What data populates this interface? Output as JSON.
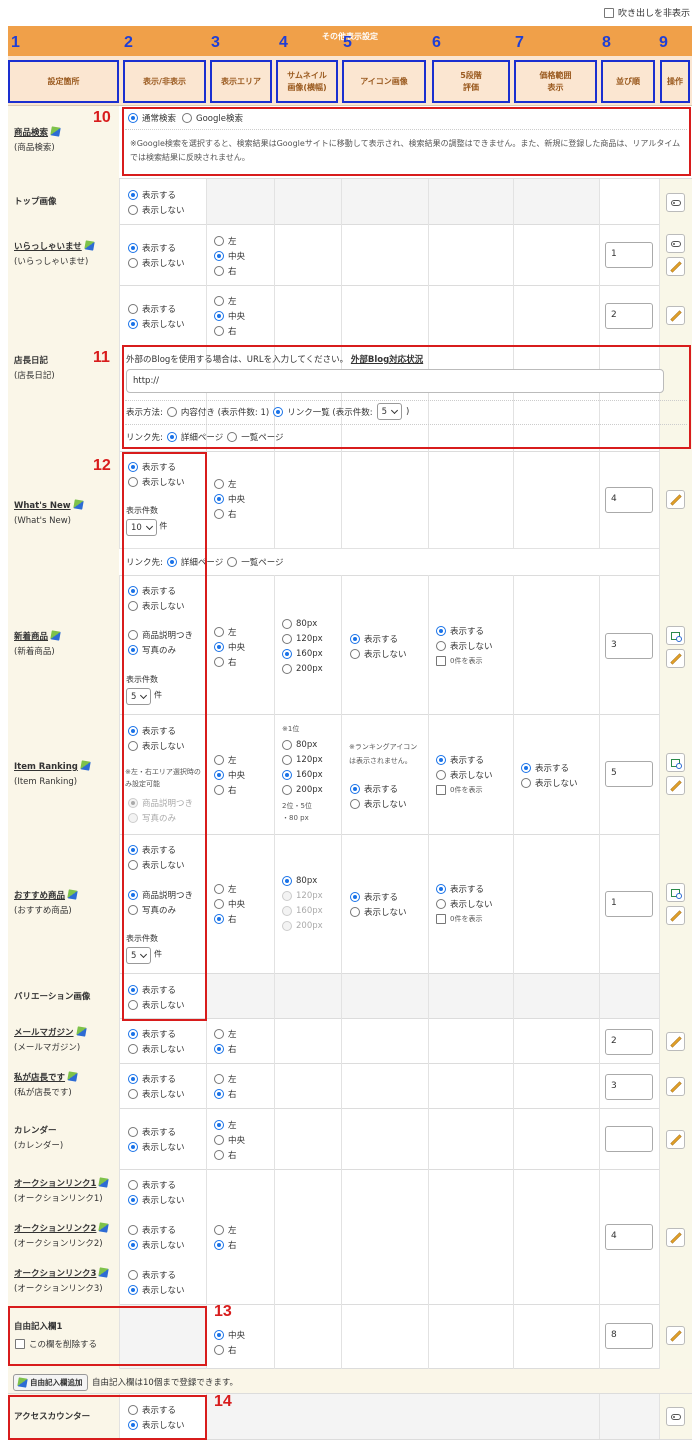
{
  "header": {
    "hide_bubbles_label": "吹き出しを非表示",
    "section_title": "その他表示設定"
  },
  "column_numbers": [
    "1",
    "2",
    "3",
    "4",
    "5",
    "6",
    "7",
    "8",
    "9"
  ],
  "columns": [
    "設定箇所",
    "表示/非表示",
    "表示エリア",
    "サムネイル\n画像(横幅)",
    "アイコン画像",
    "5段階\n評価",
    "価格範囲\n表示",
    "並び順",
    "操作"
  ],
  "annotations": [
    "10",
    "11",
    "12",
    "13",
    "14"
  ],
  "labels": {
    "show": "表示する",
    "hide": "表示しない",
    "left": "左",
    "center": "中央",
    "right": "右",
    "count": "表示件数",
    "ken": "件",
    "with_desc": "商品説明つき",
    "photo_only": "写真のみ",
    "zero_show": "0件を表示",
    "link_dest": "リンク先:",
    "detail_page": "詳細ページ",
    "list_page": "一覧ページ"
  },
  "rows": {
    "search": {
      "name": "商品検索",
      "sub": "(商品検索)",
      "opt_normal": "通常検索",
      "opt_google": "Google検索",
      "note": "※Google検索を選択すると、検索結果はGoogleサイトに移動して表示され、検索結果の調整はできません。また、新規に登録した商品は、リアルタイムでは検索結果に反映されません。"
    },
    "top_image": {
      "name": "トップ画像"
    },
    "welcome": {
      "name": "いらっしゃいませ",
      "sub": "(いらっしゃいませ)",
      "order": "1"
    },
    "diary": {
      "name": "店長日記",
      "sub": "(店長日記)",
      "order": "2",
      "blog_note": "外部のBlogを使用する場合は、URLを入力してください。",
      "blog_link": "外部Blog対応状況",
      "url_value": "http://",
      "method_label": "表示方法:",
      "opt_content": "内容付き (表示件数: 1)",
      "opt_list": "リンク一覧 (表示件数:",
      "count": "5",
      "close_paren": ")"
    },
    "whatsnew": {
      "name": "What's New",
      "sub": "(What's New)",
      "order": "4",
      "count": "10"
    },
    "new_items": {
      "name": "新着商品",
      "sub": "(新着商品)",
      "order": "3",
      "count": "5",
      "sizes": [
        "80px",
        "120px",
        "160px",
        "200px"
      ]
    },
    "ranking": {
      "name": "Item Ranking",
      "sub": "(Item Ranking)",
      "order": "5",
      "note_area": "※左・右エリア選択時のみ設定可能",
      "note_first": "※1位",
      "sizes": [
        "80px",
        "120px",
        "160px",
        "200px"
      ],
      "note_rest": "2位・5位\n・80 px",
      "icon_note": "※ランキングアイコンは表示されません。"
    },
    "recommend": {
      "name": "おすすめ商品",
      "sub": "(おすすめ商品)",
      "order": "1",
      "count": "5",
      "sizes": [
        "80px",
        "120px",
        "160px",
        "200px"
      ]
    },
    "variation": {
      "name": "バリエーション画像"
    },
    "mail": {
      "name": "メールマガジン",
      "sub": "(メールマガジン)",
      "order": "2"
    },
    "owner": {
      "name": "私が店長です",
      "sub": "(私が店長です)",
      "order": "3"
    },
    "calendar": {
      "name": "カレンダー",
      "sub": "(カレンダー)",
      "order": ""
    },
    "auction1": {
      "name": "オークションリンク1",
      "sub": "(オークションリンク1)"
    },
    "auction2": {
      "name": "オークションリンク2",
      "sub": "(オークションリンク2)",
      "order": "4"
    },
    "auction3": {
      "name": "オークションリンク3",
      "sub": "(オークションリンク3)"
    },
    "free1": {
      "name": "自由記入欄1",
      "delete_label": "この欄を削除する",
      "order": "8"
    },
    "free_add": {
      "button": "自由記入欄追加",
      "note": "自由記入欄は10個まで登録できます。"
    },
    "counter": {
      "name": "アクセスカウンター"
    }
  }
}
